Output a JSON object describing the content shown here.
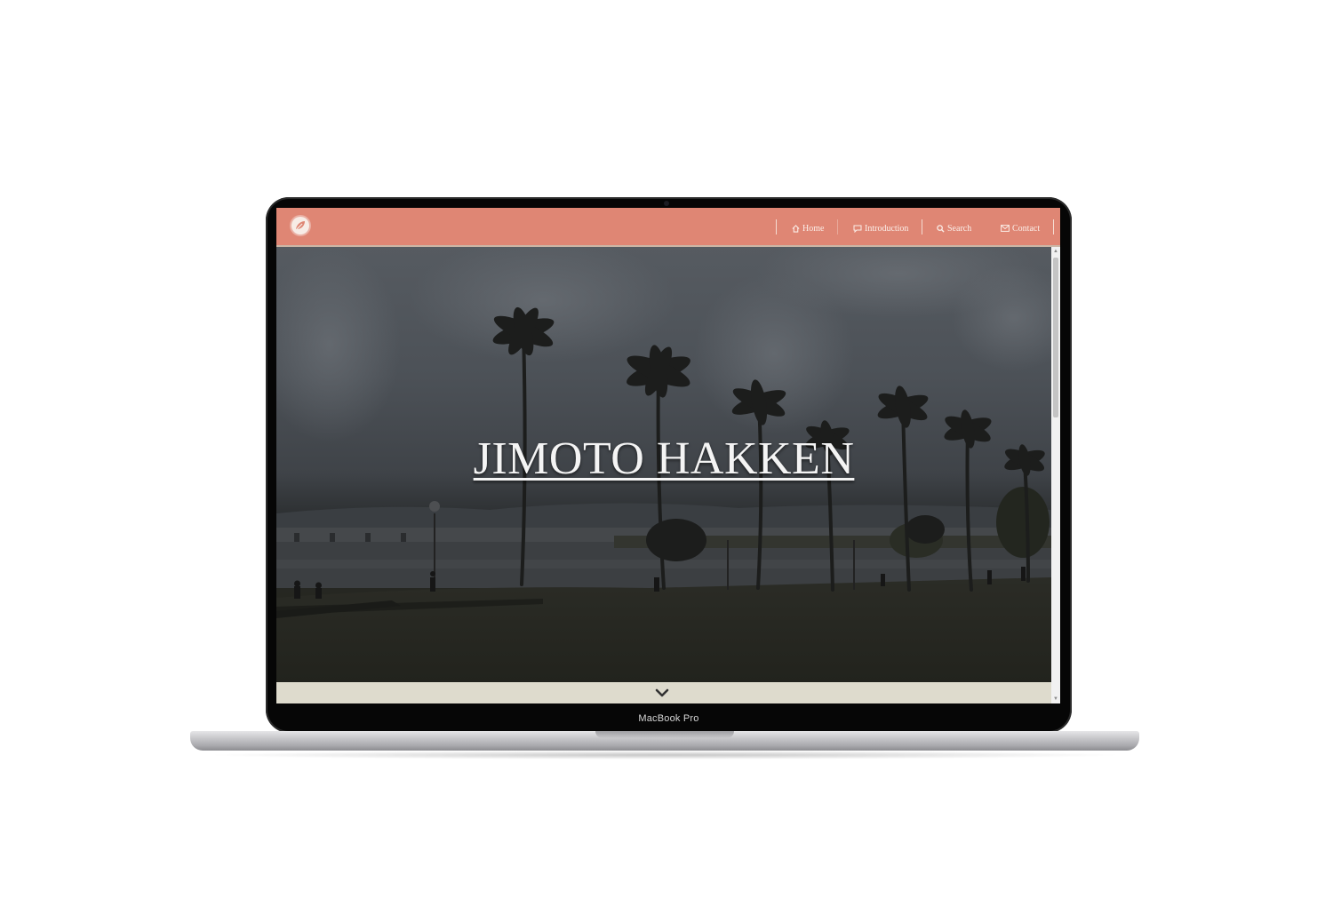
{
  "device": {
    "label": "MacBook Pro"
  },
  "site": {
    "logo_icon": "leaf-logo-icon",
    "nav": [
      {
        "label": "Home",
        "icon": "home-icon"
      },
      {
        "label": "Introduction",
        "icon": "chat-icon"
      },
      {
        "label": "Search",
        "icon": "search-icon"
      },
      {
        "label": "Contact",
        "icon": "envelope-icon"
      }
    ],
    "hero_title": "JIMOTO HAKKEN",
    "scroll_icon": "chevron-down-icon"
  },
  "colors": {
    "navbar": "#df8674",
    "footer_strip": "#dedbcd",
    "hero_text": "#f4f4f4"
  }
}
